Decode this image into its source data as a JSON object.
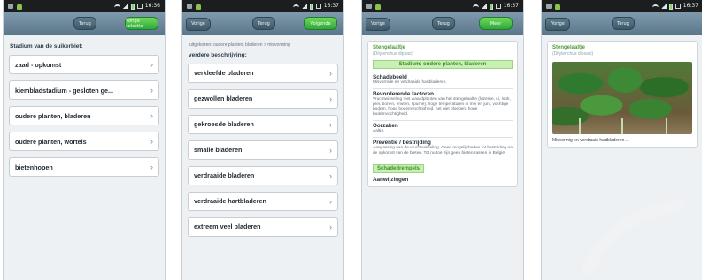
{
  "screens": [
    {
      "status": {
        "time": "16:36"
      },
      "buttons": {
        "mid": "Terug",
        "green": "Vorige selectie"
      },
      "section_title": "Stadium van de suikerbiet:",
      "items": [
        {
          "label": "zaad - opkomst"
        },
        {
          "label": "kiembladstadium - gesloten ge..."
        },
        {
          "label": "oudere planten, bladeren"
        },
        {
          "label": "oudere planten, wortels"
        },
        {
          "label": "bietenhopen"
        }
      ]
    },
    {
      "status": {
        "time": "16:37"
      },
      "buttons": {
        "back": "Vorige",
        "mid": "Terug",
        "green": "Volgende"
      },
      "breadcrumb": "uitgekozen: oudere planten, bladeren > misvorming",
      "section_title": "verdere beschrijving:",
      "items": [
        {
          "label": "verkleefde bladeren"
        },
        {
          "label": "gezwollen bladeren"
        },
        {
          "label": "gekroesde bladeren"
        },
        {
          "label": "smalle bladeren"
        },
        {
          "label": "verdraaide bladeren"
        },
        {
          "label": "verdraaide hartbladeren"
        },
        {
          "label": "extreem veel bladeren"
        }
      ]
    },
    {
      "status": {
        "time": "16:37"
      },
      "buttons": {
        "back": "Vorige",
        "mid": "Terug",
        "green": "Meer"
      },
      "plant_name": "Stengelaaltje",
      "plant_latin": "(Ditylenchus dipsaci)",
      "stadium_band": "Stadium: oudere planten, bladeren",
      "blocks": [
        {
          "heading": "Schadebeeld",
          "body": "Misvormde en verdraaide hartbladeren."
        },
        {
          "heading": "Bevorderende factoren",
          "body": "Vruchtwisseling met waardplanten van het stengelaaltje (luzerne, ui, look, prei, bonen, erwten, spurrie), hoge temperaturen in mei en juni, vochtige bodem, hoge bodemvochtigheid, het niet ploegen, hoge bodemvochtigheid."
        },
        {
          "heading": "Oorzaken",
          "body": "Aaltje."
        },
        {
          "heading": "Preventie / bestrijding",
          "body": "Aanpassing van de vruchtwisseling. Geen mogelijkheden tot bestrijding na de opkomst van de bieten. Tot nu toe zijn geen bieten rassen in België."
        }
      ],
      "tag": "Schadedrempels",
      "last_heading": "Aanwijzingen"
    },
    {
      "status": {
        "time": "16:37"
      },
      "buttons": {
        "back": "Vorige",
        "mid": "Terug"
      },
      "plant_name": "Stengelaaltje",
      "plant_latin": "(Ditylenchus dipsaci)",
      "caption": "Misvormig en verdraaid hartbladeren ..."
    }
  ],
  "colors": {
    "accent_green": "#3fb847",
    "titlebar": "#6e889a",
    "stadium_green": "#4e9a3a"
  }
}
